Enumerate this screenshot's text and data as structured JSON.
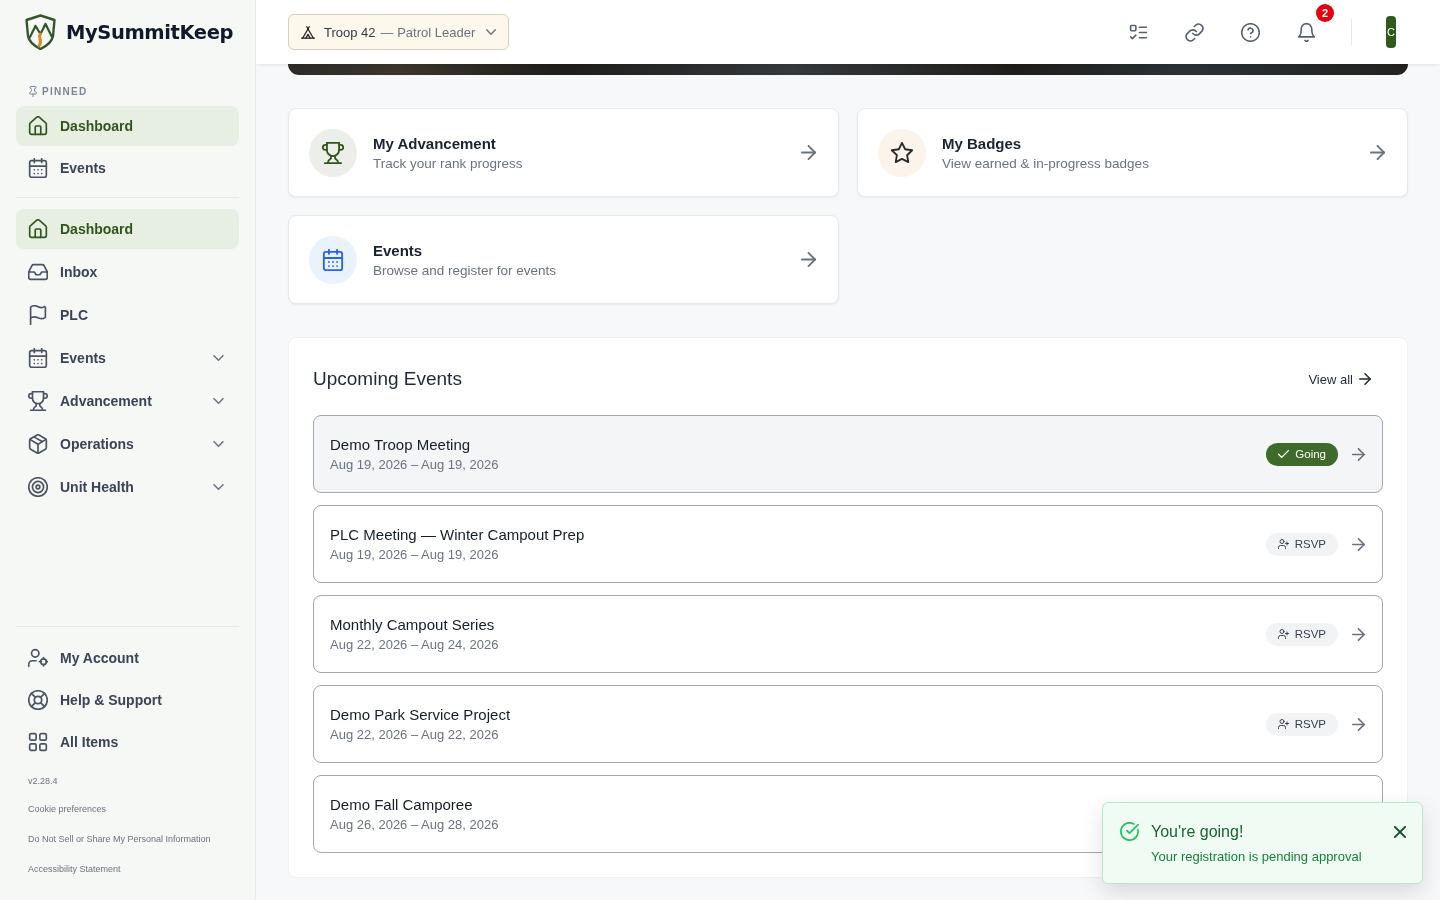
{
  "sidebar": {
    "brand": "MySummitKeep",
    "pinned_label": "PINNED",
    "pinned": [
      {
        "kind": "home",
        "label": "Dashboard",
        "selected": true
      },
      {
        "kind": "calendar",
        "label": "Events",
        "selected": false
      }
    ],
    "nav": [
      {
        "kind": "home",
        "label": "Dashboard",
        "selected": true,
        "expandable": false
      },
      {
        "kind": "inbox",
        "label": "Inbox",
        "selected": false,
        "expandable": false
      },
      {
        "kind": "flag",
        "label": "PLC",
        "selected": false,
        "expandable": false
      },
      {
        "kind": "calendar",
        "label": "Events",
        "selected": false,
        "expandable": true
      },
      {
        "kind": "trophy",
        "label": "Advancement",
        "selected": false,
        "expandable": true
      },
      {
        "kind": "package",
        "label": "Operations",
        "selected": false,
        "expandable": true
      },
      {
        "kind": "target",
        "label": "Unit Health",
        "selected": false,
        "expandable": true
      }
    ],
    "footer_nav": [
      {
        "kind": "user-gear",
        "label": "My Account"
      },
      {
        "kind": "lifebuoy",
        "label": "Help & Support"
      },
      {
        "kind": "grid",
        "label": "All Items"
      }
    ],
    "version": "v2.28.4",
    "legal_links": [
      "Cookie preferences",
      "Do Not Sell or Share My Personal Information",
      "Accessibility Statement"
    ]
  },
  "header": {
    "unit": "Troop 42",
    "role": "— Patrol Leader",
    "tools": [
      {
        "kind": "checklist"
      },
      {
        "kind": "link"
      },
      {
        "kind": "help"
      },
      {
        "kind": "bell",
        "badge": "2"
      }
    ],
    "avatar": "C"
  },
  "quick_links": [
    {
      "kind": "trophy",
      "title": "My Advancement",
      "subtitle": "Track your rank progress"
    },
    {
      "kind": "star",
      "title": "My Badges",
      "subtitle": "View earned & in-progress badges"
    },
    {
      "kind": "calendar",
      "title": "Events",
      "subtitle": "Browse and register for events"
    }
  ],
  "upcoming_events": {
    "title": "Upcoming Events",
    "view_all": "View all",
    "events": [
      {
        "name": "Demo Troop Meeting",
        "dates": "Aug 19, 2026 – Aug 19, 2026",
        "hovered": true,
        "status": {
          "kind": "going",
          "label": "Going"
        }
      },
      {
        "name": "PLC Meeting — Winter Campout Prep",
        "dates": "Aug 19, 2026 – Aug 19, 2026",
        "hovered": false,
        "status": {
          "kind": "rsvp",
          "label": "RSVP"
        }
      },
      {
        "name": "Monthly Campout Series",
        "dates": "Aug 22, 2026 – Aug 24, 2026",
        "hovered": false,
        "status": {
          "kind": "rsvp",
          "label": "RSVP"
        }
      },
      {
        "name": "Demo Park Service Project",
        "dates": "Aug 22, 2026 – Aug 22, 2026",
        "hovered": false,
        "status": {
          "kind": "rsvp",
          "label": "RSVP"
        }
      },
      {
        "name": "Demo Fall Camporee",
        "dates": "Aug 26, 2026 – Aug 28, 2026",
        "hovered": false
      }
    ]
  },
  "toast": {
    "title": "You're going!",
    "message": "Your registration is pending approval"
  }
}
